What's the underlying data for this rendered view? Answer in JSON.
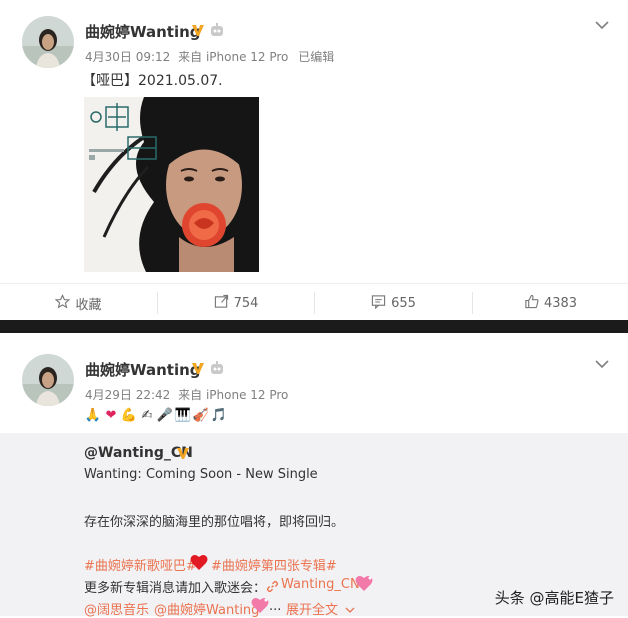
{
  "post1": {
    "author": "曲婉婷Wanting",
    "date": "4月30日 09:12",
    "source": "来自 iPhone 12 Pro",
    "edited": "已编辑",
    "text": "【哑巴】2021.05.07.",
    "actions": {
      "favorite": "收藏",
      "repost": "754",
      "comment": "655",
      "like": "4383"
    }
  },
  "post2": {
    "author": "曲婉婷Wanting",
    "date": "4月29日 22:42",
    "source": "来自 iPhone 12 Pro",
    "emojis": [
      "🙏",
      "❤",
      "💪",
      "✍",
      "🎤",
      "🎹",
      "🎻",
      "🎵"
    ]
  },
  "repost": {
    "author": "@Wanting_CN",
    "line1": "Wanting: Coming Soon - New Single",
    "line2": "存在你深深的脑海里的那位唱将，即将回归。",
    "hashtag1": "#曲婉婷新歌哑巴#",
    "hashtag2": "#曲婉婷第四张专辑#",
    "line4_prefix": "更多新专辑消息请加入歌迷会：",
    "fanclub_link": "Wanting_CN",
    "mention1": "@阔思音乐",
    "mention2": "@曲婉婷Wanting",
    "ellipsis": "...",
    "expand": "展开全文"
  },
  "watermark": {
    "text": "头条 @高能E猹子"
  },
  "colors": {
    "link": "#eb7350",
    "vip": "#f5a623",
    "divider": "#1b1b1b",
    "repost_bg": "#f2f2f5"
  }
}
